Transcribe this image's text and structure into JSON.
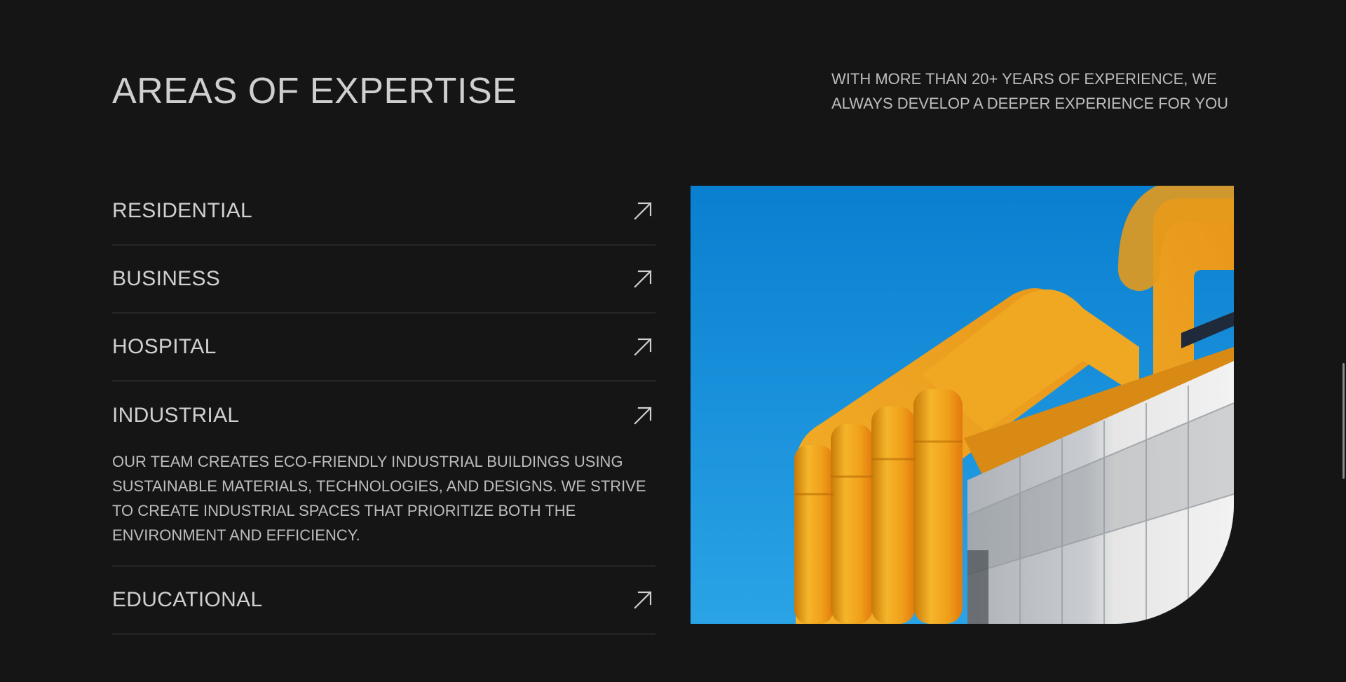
{
  "section": {
    "title": "AREAS OF EXPERTISE",
    "intro": "WITH MORE THAN 20+ YEARS OF EXPERIENCE, WE ALWAYS DEVELOP A DEEPER EXPERIENCE FOR YOU"
  },
  "accordion": {
    "items": [
      {
        "label": "RESIDENTIAL",
        "icon": "arrow-up-right-icon",
        "expanded": false
      },
      {
        "label": "BUSINESS",
        "icon": "arrow-up-right-icon",
        "expanded": false
      },
      {
        "label": "HOSPITAL",
        "icon": "arrow-up-right-icon",
        "expanded": false
      },
      {
        "label": "INDUSTRIAL",
        "icon": "arrow-up-right-icon",
        "expanded": true,
        "description": "OUR TEAM CREATES ECO-FRIENDLY INDUSTRIAL BUILDINGS USING SUSTAINABLE MATERIALS, TECHNOLOGIES, AND DESIGNS. WE STRIVE TO CREATE INDUSTRIAL SPACES THAT PRIORITIZE BOTH THE ENVIRONMENT AND EFFICIENCY."
      },
      {
        "label": "EDUCATIONAL",
        "icon": "arrow-up-right-icon",
        "expanded": false
      }
    ]
  },
  "colors": {
    "background": "#151515",
    "text": "#d0d0d0",
    "divider": "#444444",
    "sky": "#0a7fd0",
    "pipes": "#f2a51a"
  }
}
